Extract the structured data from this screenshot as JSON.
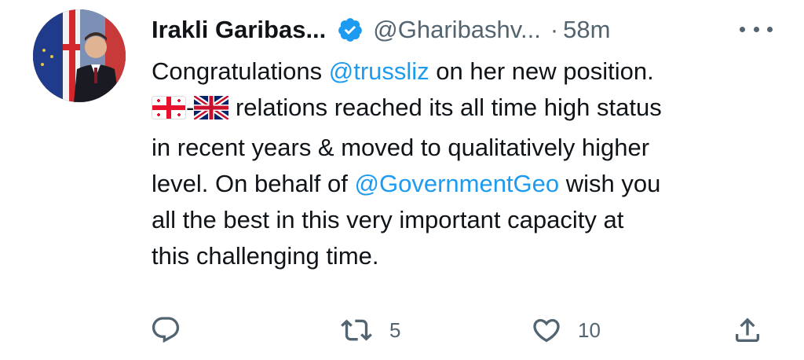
{
  "tweet": {
    "author": {
      "display_name": "Irakli Garibas...",
      "handle": "@Gharibashv...",
      "verified": true,
      "avatar_icon": "profile-photo"
    },
    "separator": "·",
    "time": "58m",
    "text": {
      "line1": {
        "before": "Congratulations ",
        "mention": "@trussliz",
        "after": " on her new position."
      },
      "line2": {
        "flag1_icon": "georgia-flag-icon",
        "dash": "-",
        "flag2_icon": "uk-flag-icon",
        "after": " relations reached its all time high status"
      },
      "line3": "in recent years & moved to qualitatively higher",
      "line4": {
        "before": "level. On behalf of ",
        "mention": "@GovernmentGeo",
        "after": " wish you"
      },
      "line5": "all the best in this very important capacity at",
      "line6": "this challenging time."
    },
    "actions": {
      "reply": {
        "icon": "reply-icon",
        "count": ""
      },
      "retweet": {
        "icon": "retweet-icon",
        "count": "5"
      },
      "like": {
        "icon": "heart-icon",
        "count": "10"
      },
      "share": {
        "icon": "share-icon"
      }
    },
    "colors": {
      "text": "#0f1419",
      "secondary": "#536471",
      "accent": "#1d9bf0"
    }
  }
}
